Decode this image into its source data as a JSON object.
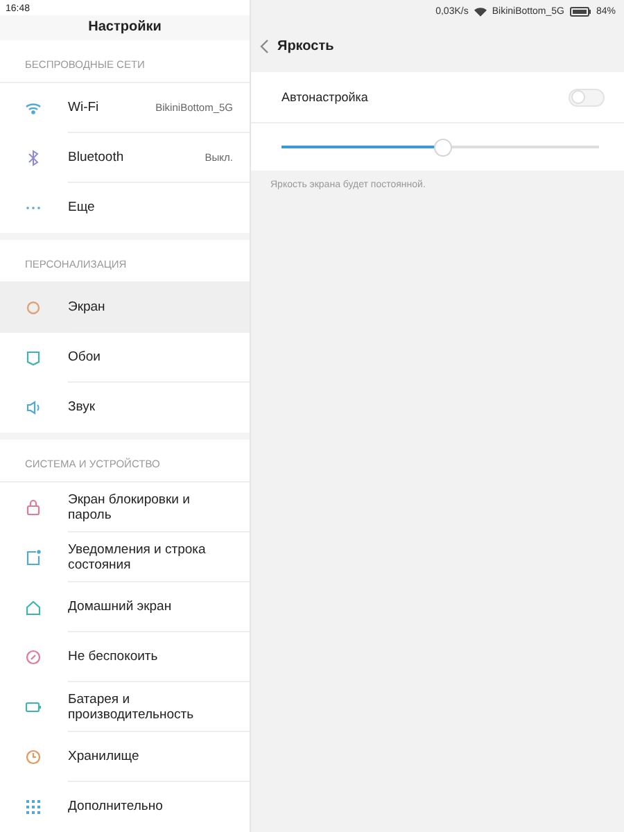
{
  "status_bar": {
    "time": "16:48",
    "speed": "0,03K/s",
    "network": "BikiniBottom_5G",
    "battery": "84%"
  },
  "sidebar": {
    "title": "Настройки",
    "sections": [
      {
        "header": "БЕСПРОВОДНЫЕ СЕТИ",
        "items": [
          {
            "label": "Wi-Fi",
            "value": "BikiniBottom_5G",
            "selected": false
          },
          {
            "label": "Bluetooth",
            "value": "Выкл.",
            "selected": false
          },
          {
            "label": "Еще",
            "selected": false
          }
        ]
      },
      {
        "header": "ПЕРСОНАЛИЗАЦИЯ",
        "items": [
          {
            "label": "Экран",
            "selected": true
          },
          {
            "label": "Обои",
            "selected": false
          },
          {
            "label": "Звук",
            "selected": false
          }
        ]
      },
      {
        "header": "СИСТЕМА И УСТРОЙСТВО",
        "items": [
          {
            "label": "Экран блокировки и пароль",
            "selected": false
          },
          {
            "label": "Уведомления и строка состояния",
            "selected": false
          },
          {
            "label": "Домашний экран",
            "selected": false
          },
          {
            "label": "Не беспокоить",
            "selected": false
          },
          {
            "label": "Батарея и производительность",
            "selected": false
          },
          {
            "label": "Хранилище",
            "selected": false
          },
          {
            "label": "Дополнительно",
            "selected": false
          }
        ]
      }
    ]
  },
  "detail": {
    "title": "Яркость",
    "auto": {
      "label": "Автонастройка",
      "on": false
    },
    "brightness": {
      "level": 0.51
    },
    "note": "Яркость экрана будет постоянной."
  }
}
